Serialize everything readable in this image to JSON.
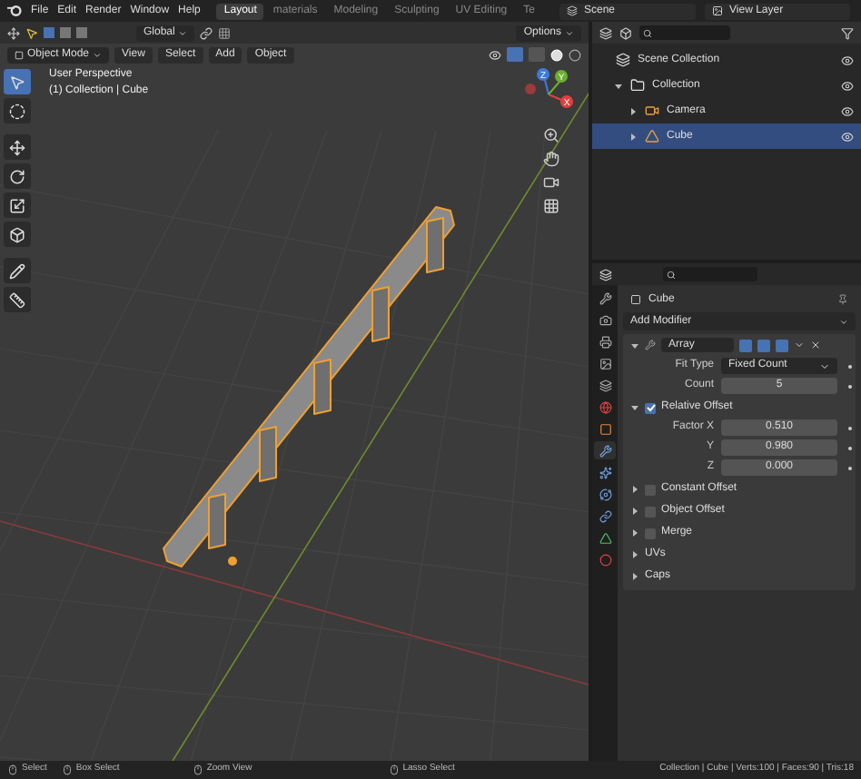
{
  "top_bar": {
    "menus": [
      "File",
      "Edit",
      "Render",
      "Window",
      "Help"
    ],
    "workspace_tabs": [
      {
        "label": "Layout",
        "selected": true
      },
      {
        "label": "materials",
        "selected": false
      },
      {
        "label": "Modeling",
        "selected": false
      },
      {
        "label": "Sculpting",
        "selected": false
      },
      {
        "label": "UV Editing",
        "selected": false
      },
      {
        "label": "Te",
        "selected": false
      }
    ],
    "scene": "Scene",
    "view_layer": "View Layer"
  },
  "viewport": {
    "orientation": "Global",
    "options": "Options",
    "mode": "Object Mode",
    "menus": [
      "View",
      "Select",
      "Add",
      "Object"
    ],
    "overlay_text": [
      "User Perspective",
      "(1) Collection | Cube"
    ],
    "tools": [
      {
        "kind": "select",
        "selected": true
      },
      {
        "kind": "cursor",
        "selected": false
      },
      {
        "kind": "move",
        "selected": false
      },
      {
        "kind": "rotate",
        "selected": false
      },
      {
        "kind": "scale",
        "selected": false
      },
      {
        "kind": "transform",
        "selected": false
      },
      {
        "kind": "annotate",
        "selected": false
      },
      {
        "kind": "measure",
        "selected": false
      }
    ],
    "gizmo_labels": [
      "Z",
      "Y",
      "X"
    ]
  },
  "outliner": {
    "tree": [
      {
        "label": "Scene Collection",
        "kind": "scene",
        "selected": false,
        "children": [
          {
            "label": "Collection",
            "kind": "collection",
            "selected": false,
            "expanded": true,
            "children": [
              {
                "label": "Camera",
                "kind": "camera",
                "selected": false,
                "expanded": false
              },
              {
                "label": "Cube",
                "kind": "mesh",
                "selected": true,
                "expanded": false
              }
            ]
          }
        ]
      }
    ]
  },
  "properties": {
    "tabs": [
      {
        "kind": "tool",
        "selected": false
      },
      {
        "kind": "render",
        "selected": false
      },
      {
        "kind": "output",
        "selected": false
      },
      {
        "kind": "view_layer",
        "selected": false
      },
      {
        "kind": "scene",
        "selected": false
      },
      {
        "kind": "world",
        "selected": false
      },
      {
        "kind": "object",
        "selected": false
      },
      {
        "kind": "modifiers",
        "selected": true
      },
      {
        "kind": "particles",
        "selected": false
      },
      {
        "kind": "physics",
        "selected": false
      },
      {
        "kind": "constraints",
        "selected": false
      },
      {
        "kind": "data",
        "selected": false
      },
      {
        "kind": "material",
        "selected": false
      }
    ],
    "object_name": "Cube",
    "add_modifier": "Add Modifier",
    "modifier": {
      "name": "Array",
      "expanded": true,
      "fields": [
        {
          "label": "Fit Type",
          "value": "Fixed Count",
          "kind": "dropdown"
        },
        {
          "label": "Count",
          "value": "5",
          "kind": "number"
        }
      ],
      "sections": [
        {
          "label": "Relative Offset",
          "kind": "checkbox",
          "checked": true,
          "expanded": true,
          "fields": [
            {
              "label": "Factor X",
              "value": "0.510"
            },
            {
              "label": "Y",
              "value": "0.980"
            },
            {
              "label": "Z",
              "value": "0.000"
            }
          ]
        },
        {
          "label": "Constant Offset",
          "kind": "checkbox",
          "checked": false,
          "expanded": false
        },
        {
          "label": "Object Offset",
          "kind": "checkbox",
          "checked": false,
          "expanded": false
        },
        {
          "label": "Merge",
          "kind": "checkbox",
          "checked": false,
          "expanded": false
        },
        {
          "label": "UVs",
          "kind": "plain",
          "expanded": false
        },
        {
          "label": "Caps",
          "kind": "plain",
          "expanded": false
        }
      ]
    }
  },
  "status_bar": {
    "hints": [
      {
        "label": "Select"
      },
      {
        "label": "Box Select"
      },
      {
        "label": "Zoom View"
      },
      {
        "label": "Lasso Select"
      }
    ],
    "info": "Collection | Cube | Verts:100 | Faces:90 | Tris:18"
  }
}
